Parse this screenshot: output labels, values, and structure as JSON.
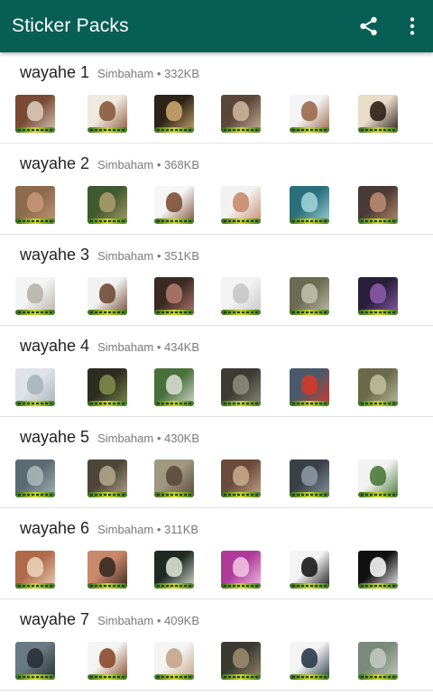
{
  "appbar": {
    "title": "Sticker Packs",
    "icons": [
      "share-icon",
      "more-vert-icon"
    ],
    "color": "#075e54"
  },
  "packs": [
    {
      "name": "wayahe 1",
      "author": "Simbaham",
      "size": "332KB",
      "stickers": [
        [
          "#7a4a34",
          "#d9c9b8"
        ],
        [
          "#efe9e0",
          "#8b5a3c"
        ],
        [
          "#2c2418",
          "#c8a46c"
        ],
        [
          "#5b4738",
          "#c9b49a"
        ],
        [
          "#f4f4f4",
          "#9b6a4a"
        ],
        [
          "#e9dccb",
          "#2d2016"
        ]
      ]
    },
    {
      "name": "wayahe 2",
      "author": "Simbaham",
      "size": "368KB",
      "stickers": [
        [
          "#8c6a4e",
          "#c49676"
        ],
        [
          "#3f5a2e",
          "#a89a6b"
        ],
        [
          "#f6f6f6",
          "#7d5036"
        ],
        [
          "#f2f2f2",
          "#c98b6e"
        ],
        [
          "#2a6f7a",
          "#9fd0d8"
        ],
        [
          "#4a3a35",
          "#b88a6e"
        ]
      ]
    },
    {
      "name": "wayahe 3",
      "author": "Simbaham",
      "size": "351KB",
      "stickers": [
        [
          "#f4f4f4",
          "#b9b2a8"
        ],
        [
          "#f2f2f2",
          "#6f4b35"
        ],
        [
          "#3a2b22",
          "#b0766a"
        ],
        [
          "#f3f3f3",
          "#c7c7c7"
        ],
        [
          "#6b6a52",
          "#bfbfa8"
        ],
        [
          "#2a1f3a",
          "#8a5aa8"
        ]
      ]
    },
    {
      "name": "wayahe 4",
      "author": "Simbaham",
      "size": "434KB",
      "stickers": [
        [
          "#dde3e8",
          "#a9b2ba"
        ],
        [
          "#2c2c20",
          "#7d8a4a"
        ],
        [
          "#48703a",
          "#d6d9cf"
        ],
        [
          "#3b3b33",
          "#8a8a7a"
        ],
        [
          "#4a5a6a",
          "#d23a2a"
        ],
        [
          "#6a6a4a",
          "#bdbda0"
        ]
      ]
    },
    {
      "name": "wayahe 5",
      "author": "Simbaham",
      "size": "430KB",
      "stickers": [
        [
          "#5a6b72",
          "#a8b4b8"
        ],
        [
          "#4c4538",
          "#b0a48a"
        ],
        [
          "#a09880",
          "#5a4a3a"
        ],
        [
          "#6a4a3a",
          "#c4a88a"
        ],
        [
          "#3a4048",
          "#8a95a0"
        ],
        [
          "#f2f2f2",
          "#4a7a3a"
        ]
      ]
    },
    {
      "name": "wayahe 6",
      "author": "Simbaham",
      "size": "311KB",
      "stickers": [
        [
          "#b06a4a",
          "#ead0b8"
        ],
        [
          "#c9886a",
          "#3a2a22"
        ],
        [
          "#1e2a22",
          "#d8e0d0"
        ],
        [
          "#b03a9a",
          "#f0c0e0"
        ],
        [
          "#f4f4f4",
          "#1a1a1a"
        ],
        [
          "#111111",
          "#f4f4f4"
        ]
      ]
    },
    {
      "name": "wayahe 7",
      "author": "Simbaham",
      "size": "409KB",
      "stickers": [
        [
          "#6a7a82",
          "#2a3038"
        ],
        [
          "#f4f4f4",
          "#8a4a2a"
        ],
        [
          "#f4f4f4",
          "#c4a48a"
        ],
        [
          "#3a3a32",
          "#9a8a6a"
        ],
        [
          "#f4f4f4",
          "#2a3a4a"
        ],
        [
          "#7a8a7a",
          "#c0c8c0"
        ]
      ]
    }
  ]
}
